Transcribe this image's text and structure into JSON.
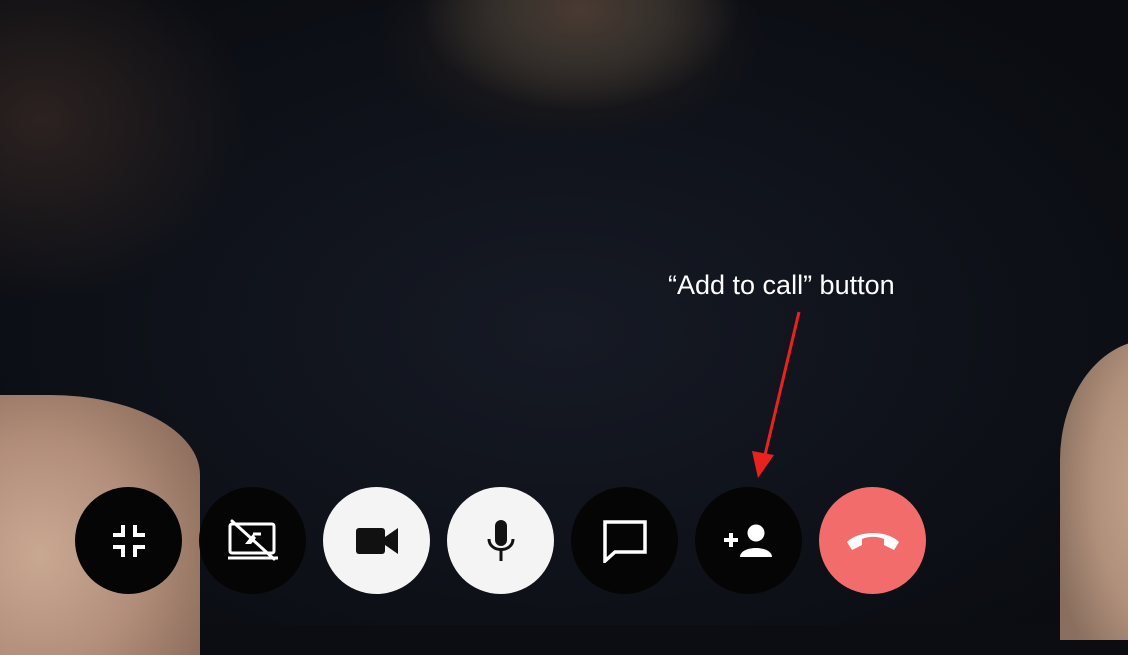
{
  "annotation": {
    "text": "“Add to call” button"
  },
  "colors": {
    "dark_button": "#050505",
    "light_button": "#f4f4f4",
    "end_call_button": "#f36c6c",
    "arrow": "#e8231f"
  },
  "controls": [
    {
      "name": "exit-fullscreen-button",
      "icon": "exit-fullscreen-icon"
    },
    {
      "name": "stop-screen-share-button",
      "icon": "screen-share-off-icon"
    },
    {
      "name": "camera-button",
      "icon": "video-camera-icon"
    },
    {
      "name": "microphone-button",
      "icon": "microphone-icon"
    },
    {
      "name": "chat-button",
      "icon": "chat-bubble-icon"
    },
    {
      "name": "add-to-call-button",
      "icon": "add-person-icon"
    },
    {
      "name": "end-call-button",
      "icon": "hang-up-phone-icon"
    }
  ]
}
